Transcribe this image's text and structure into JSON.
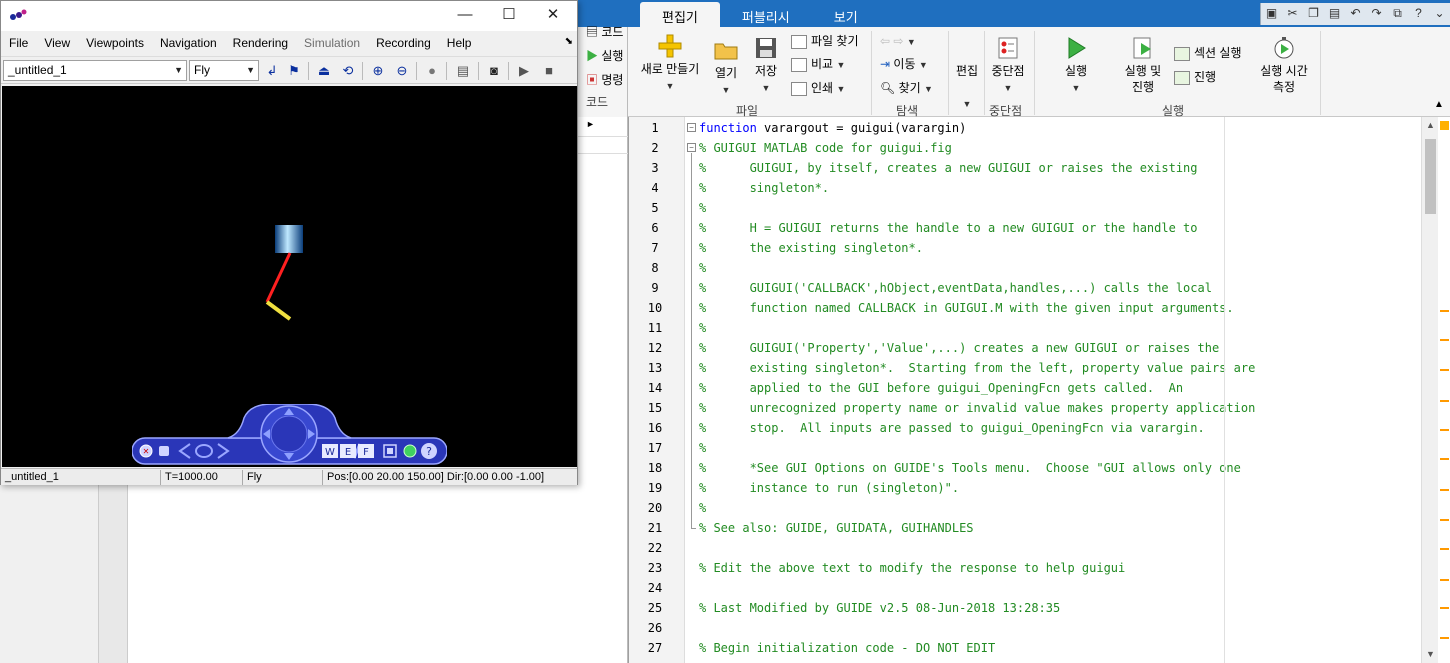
{
  "vrml_window": {
    "menus": [
      "File",
      "View",
      "Viewpoints",
      "Navigation",
      "Rendering",
      "Simulation",
      "Recording",
      "Help"
    ],
    "disabled_menu": "Simulation",
    "viewpoint_select": "_untitled_1",
    "navigation_select": "Fly",
    "status": {
      "viewpoint": "_untitled_1",
      "time": "T=1000.00",
      "mode": "Fly",
      "pos_dir": "Pos:[0.00 20.00 150.00] Dir:[0.00 0.00 -1.00]"
    },
    "nav_panel": {
      "w_label": "W",
      "e_label": "E",
      "f_label": "F",
      "help_label": "?"
    },
    "colors": {
      "canvas_bg": "#000000",
      "cylinder": "#3aa0e0",
      "red_link": "#ff2020",
      "yellow_link": "#f0e040",
      "nav_blue": "#2a36b8"
    }
  },
  "matlab": {
    "tabs": [
      "편집기",
      "퍼블리시",
      "보기"
    ],
    "active_tab": "편집기",
    "left_strip": [
      "코드",
      "실행",
      "명령",
      "코드"
    ],
    "ribbon": {
      "file_group": "파일",
      "new": "새로 만들기",
      "open": "열기",
      "save": "저장",
      "find_files": "파일 찾기",
      "compare": "비교",
      "print": "인쇄",
      "nav_group": "탐색",
      "goto": "이동",
      "find": "찾기",
      "edit": "편집",
      "breakpoints": "중단점",
      "breakpoints_group": "중단점",
      "run": "실행",
      "run_advance": [
        "실행 및",
        "진행"
      ],
      "run_section": "섹션 실행",
      "advance": "진행",
      "run_time": [
        "실행 시간",
        "측정"
      ],
      "run_group": "실행"
    },
    "editor": {
      "lines": [
        {
          "n": "1",
          "kw": "function",
          "text": " varargout = guigui(varargin)"
        },
        {
          "n": "2",
          "c": "% GUIGUI MATLAB code for guigui.fig"
        },
        {
          "n": "3",
          "c": "%      GUIGUI, by itself, creates a new GUIGUI or raises the existing"
        },
        {
          "n": "4",
          "c": "%      singleton*."
        },
        {
          "n": "5",
          "c": "%"
        },
        {
          "n": "6",
          "c": "%      H = GUIGUI returns the handle to a new GUIGUI or the handle to"
        },
        {
          "n": "7",
          "c": "%      the existing singleton*."
        },
        {
          "n": "8",
          "c": "%"
        },
        {
          "n": "9",
          "c": "%      GUIGUI('CALLBACK',hObject,eventData,handles,...) calls the local"
        },
        {
          "n": "10",
          "c": "%      function named CALLBACK in GUIGUI.M with the given input arguments."
        },
        {
          "n": "11",
          "c": "%"
        },
        {
          "n": "12",
          "c": "%      GUIGUI('Property','Value',...) creates a new GUIGUI or raises the"
        },
        {
          "n": "13",
          "c": "%      existing singleton*.  Starting from the left, property value pairs are"
        },
        {
          "n": "14",
          "c": "%      applied to the GUI before guigui_OpeningFcn gets called.  An"
        },
        {
          "n": "15",
          "c": "%      unrecognized property name or invalid value makes property application"
        },
        {
          "n": "16",
          "c": "%      stop.  All inputs are passed to guigui_OpeningFcn via varargin."
        },
        {
          "n": "17",
          "c": "%"
        },
        {
          "n": "18",
          "c": "%      *See GUI Options on GUIDE's Tools menu.  Choose \"GUI allows only one"
        },
        {
          "n": "19",
          "c": "%      instance to run (singleton)\"."
        },
        {
          "n": "20",
          "c": "%"
        },
        {
          "n": "21",
          "c": "% See also: GUIDE, GUIDATA, GUIHANDLES"
        },
        {
          "n": "22",
          "c": ""
        },
        {
          "n": "23",
          "c": "% Edit the above text to modify the response to help guigui"
        },
        {
          "n": "24",
          "c": ""
        },
        {
          "n": "25",
          "c": "% Last Modified by GUIDE v2.5 08-Jun-2018 13:28:35"
        },
        {
          "n": "26",
          "c": ""
        },
        {
          "n": "27",
          "c": "% Begin initialization code - DO NOT EDIT"
        }
      ],
      "colors": {
        "comment": "#228b22",
        "keyword": "#0000ff"
      }
    },
    "colors": {
      "titlebar": "#1f6fbf",
      "marker": "#ff9900"
    }
  }
}
